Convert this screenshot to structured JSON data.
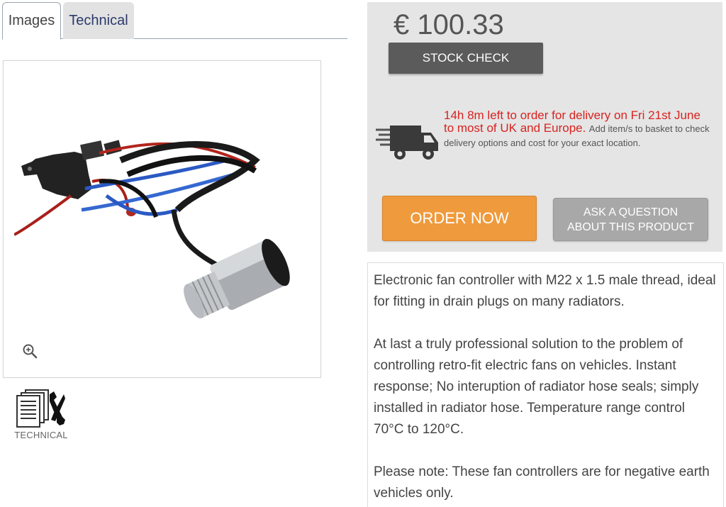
{
  "tabs": [
    {
      "label": "Images"
    },
    {
      "label": "Technical"
    }
  ],
  "technical_thumb": {
    "label": "TECHNICAL"
  },
  "purchase": {
    "price": "€ 100.33",
    "stock_check_label": "STOCK CHECK",
    "delivery_urgent": "14h 8m left to order for delivery on Fri 21st June to most of UK and Europe.",
    "delivery_note": "Add item/s to basket to check delivery options and cost for your exact location.",
    "order_label": "ORDER NOW",
    "ask_line1": "ASK A QUESTION",
    "ask_line2": "ABOUT THIS PRODUCT"
  },
  "description": {
    "paragraphs": [
      "Electronic fan controller with M22 x 1.5 male thread, ideal for fitting in drain plugs on many radiators.",
      "At last a truly professional solution to the problem of controlling retro-fit electric fans on vehicles. Instant response; No interuption of radiator hose seals; simply installed in radiator hose. Temperature range control 70°C to 120°C.",
      "Please note: These fan controllers are for negative earth vehicles only."
    ]
  },
  "colors": {
    "order_button": "#ef9a3c",
    "delivery_text": "#d8231f",
    "stock_button": "#5b5b5b",
    "tab_link": "#2b3a6b"
  },
  "icons": [
    "zoom-in-icon",
    "technical-documents-icon",
    "delivery-truck-icon"
  ]
}
